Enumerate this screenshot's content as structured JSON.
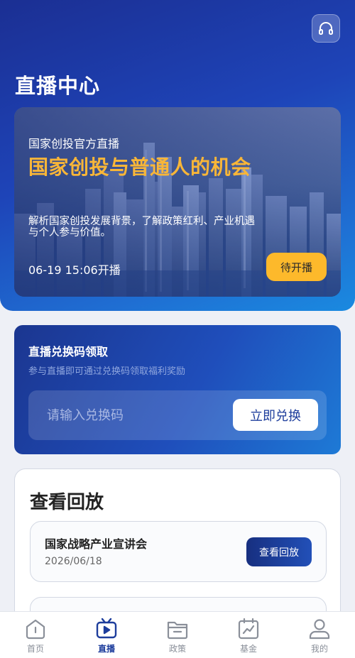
{
  "header": {
    "title": "直播中心",
    "headset_icon": "headset-icon"
  },
  "live_card": {
    "subtitle": "国家创投官方直播",
    "title": "国家创投与普通人的机会",
    "description": "解析国家创投发展背景，了解政策红利、产业机遇与个人参与价值。",
    "time": "06-19 15:06开播",
    "status_label": "待开播",
    "accent_color": "#f9b638",
    "status_color": "#fdb92b"
  },
  "redeem": {
    "title": "直播兑换码领取",
    "subtitle": "参与直播即可通过兑换码领取福利奖励",
    "placeholder": "请输入兑换码",
    "value": "",
    "button_label": "立即兑换"
  },
  "replay": {
    "title": "查看回放",
    "items": [
      {
        "title": "国家战略产业宣讲会",
        "date": "2026/06/18",
        "button_label": "查看回放"
      },
      {
        "title": "",
        "date": "",
        "button_label": ""
      }
    ]
  },
  "tabbar": {
    "active": "直播",
    "items": [
      {
        "label": "首页",
        "icon": "home-icon"
      },
      {
        "label": "直播",
        "icon": "live-tv-icon"
      },
      {
        "label": "政策",
        "icon": "folder-icon"
      },
      {
        "label": "基金",
        "icon": "chart-icon"
      },
      {
        "label": "我的",
        "icon": "user-icon"
      }
    ]
  },
  "colors": {
    "primary": "#1d3d9c",
    "hero_start": "#1b2f93",
    "hero_end": "#1a8ae0"
  }
}
